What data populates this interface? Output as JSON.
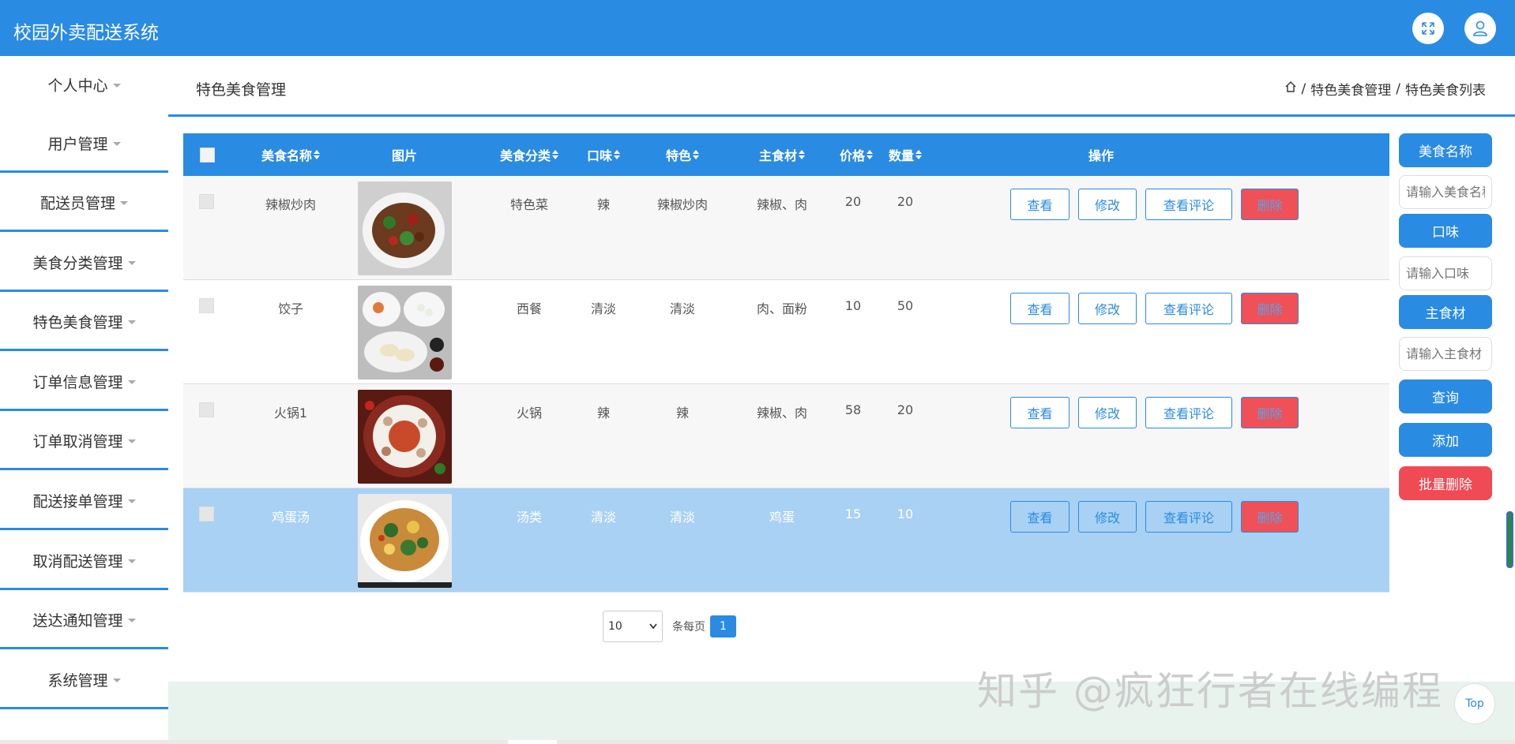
{
  "app": {
    "title": "校园外卖配送系统"
  },
  "sidebar": {
    "items": [
      {
        "label": "个人中心"
      },
      {
        "label": "用户管理"
      },
      {
        "label": "配送员管理"
      },
      {
        "label": "美食分类管理"
      },
      {
        "label": "特色美食管理"
      },
      {
        "label": "订单信息管理"
      },
      {
        "label": "订单取消管理"
      },
      {
        "label": "配送接单管理"
      },
      {
        "label": "取消配送管理"
      },
      {
        "label": "送达通知管理"
      },
      {
        "label": "系统管理"
      }
    ]
  },
  "header": {
    "title": "特色美食管理",
    "breadcrumb": {
      "separator": "/",
      "items": [
        "特色美食管理",
        "特色美食列表"
      ]
    }
  },
  "table": {
    "columns": [
      "美食名称",
      "图片",
      "美食分类",
      "口味",
      "特色",
      "主食材",
      "价格",
      "数量",
      "操作"
    ],
    "rows": [
      {
        "name": "辣椒炒肉",
        "category": "特色菜",
        "taste": "辣",
        "feature": "辣椒炒肉",
        "ingredient": "辣椒、肉",
        "price": "20",
        "quantity": "20"
      },
      {
        "name": "饺子",
        "category": "西餐",
        "taste": "清淡",
        "feature": "清淡",
        "ingredient": "肉、面粉",
        "price": "10",
        "quantity": "50"
      },
      {
        "name": "火锅1",
        "category": "火锅",
        "taste": "辣",
        "feature": "辣",
        "ingredient": "辣椒、肉",
        "price": "58",
        "quantity": "20"
      },
      {
        "name": "鸡蛋汤",
        "category": "汤类",
        "taste": "清淡",
        "feature": "清淡",
        "ingredient": "鸡蛋",
        "price": "15",
        "quantity": "10"
      }
    ],
    "actions": {
      "view": "查看",
      "edit": "修改",
      "comments": "查看评论",
      "delete": "删除"
    }
  },
  "search": {
    "name_label": "美食名称",
    "name_placeholder": "请输入美食名称",
    "taste_label": "口味",
    "taste_placeholder": "请输入口味",
    "ingredient_label": "主食材",
    "ingredient_placeholder": "请输入主食材",
    "query": "查询",
    "add": "添加",
    "batch_delete": "批量删除"
  },
  "pagination": {
    "page_size": "10",
    "per_page_label": "条每页",
    "current_page": "1"
  },
  "watermark": "知乎 @疯狂行者在线编程",
  "top_button": "Top",
  "colors": {
    "primary": "#2a8be3",
    "danger": "#f05057",
    "selected_row": "#a9d1f3"
  },
  "icons": {
    "fullscreen": "fullscreen-icon",
    "user": "user-icon",
    "home": "home-icon"
  }
}
